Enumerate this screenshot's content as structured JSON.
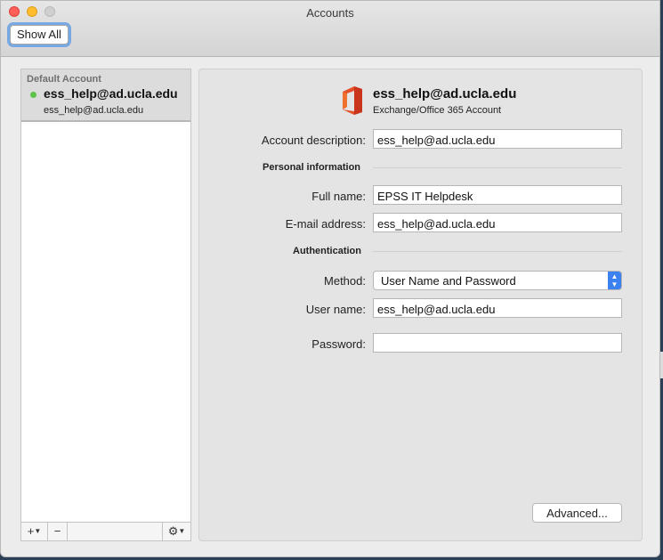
{
  "window": {
    "title": "Accounts"
  },
  "toolbar": {
    "show_all_label": "Show All"
  },
  "sidebar": {
    "group_header": "Default Account",
    "account": {
      "name": "ess_help@ad.ucla.edu",
      "subtitle": "ess_help@ad.ucla.edu",
      "status_color": "#5cc24a"
    },
    "buttons": {
      "add": "+",
      "remove": "−",
      "gear": "⚙"
    }
  },
  "account_detail": {
    "title": "ess_help@ad.ucla.edu",
    "type": "Exchange/Office 365 Account",
    "description_label": "Account description:",
    "description_value": "ess_help@ad.ucla.edu",
    "personal_section": "Personal information",
    "full_name_label": "Full name:",
    "full_name_value": "EPSS IT Helpdesk",
    "email_label": "E-mail address:",
    "email_value": "ess_help@ad.ucla.edu",
    "auth_section": "Authentication",
    "method_label": "Method:",
    "method_value": "User Name and Password",
    "username_label": "User name:",
    "username_value": "ess_help@ad.ucla.edu",
    "password_label": "Password:",
    "password_value": "",
    "advanced_label": "Advanced..."
  },
  "colors": {
    "accent": "#3b82f0",
    "focus_ring": "#77a8e4"
  }
}
